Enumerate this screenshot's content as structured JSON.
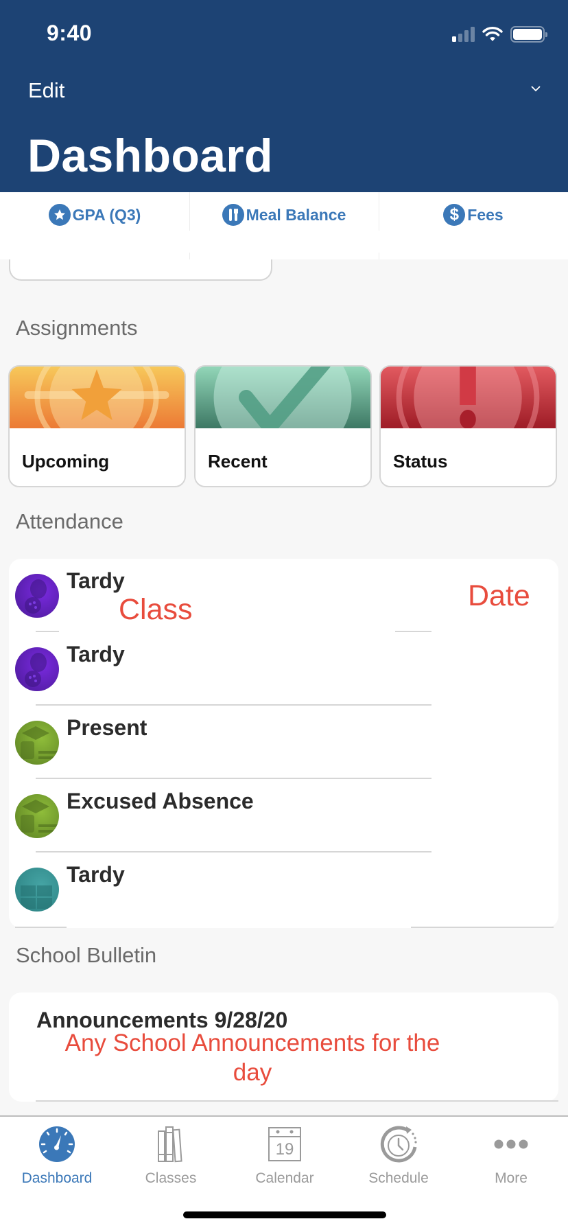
{
  "status_bar": {
    "time": "9:40",
    "icons": [
      "signal-icon",
      "wifi-icon",
      "battery-icon"
    ]
  },
  "header": {
    "edit_label": "Edit",
    "title": "Dashboard",
    "chevron_icon": "chevron-down-icon"
  },
  "quick_tabs": [
    {
      "label": "GPA (Q3)",
      "icon": "star-icon"
    },
    {
      "label": "Meal Balance",
      "icon": "utensils-icon"
    },
    {
      "label": "Fees",
      "icon": "dollar-icon"
    }
  ],
  "sections": {
    "assignments": "Assignments",
    "attendance": "Attendance",
    "bulletin": "School Bulletin"
  },
  "assignments": [
    {
      "label": "Upcoming",
      "icon": "star-badge-icon",
      "colors": [
        "#f7c85a",
        "#ec7a35"
      ]
    },
    {
      "label": "Recent",
      "icon": "checkmark-icon",
      "colors": [
        "#92d6b8",
        "#3d7864"
      ]
    },
    {
      "label": "Status",
      "icon": "exclamation-icon",
      "colors": [
        "#e25a60",
        "#9e1c26"
      ]
    }
  ],
  "attendance": {
    "class_placeholder": "Class",
    "date_placeholder": "Date",
    "rows": [
      {
        "status": "Tardy",
        "avatar": "theater-masks-icon",
        "color": "#5b1fa8"
      },
      {
        "status": "Tardy",
        "avatar": "theater-masks-icon",
        "color": "#5b1fa8"
      },
      {
        "status": "Present",
        "avatar": "graduation-icon",
        "color": "#6f9a2c"
      },
      {
        "status": "Excused Absence",
        "avatar": "graduation-icon",
        "color": "#6f9a2c"
      },
      {
        "status": "Tardy",
        "avatar": "calculator-icon",
        "color": "#2f8b8b"
      }
    ]
  },
  "bulletin": {
    "title": "Announcements 9/28/20",
    "body": "Any School Announcements for the day"
  },
  "tabbar": [
    {
      "label": "Dashboard",
      "icon": "dashboard-gauge-icon",
      "active": true
    },
    {
      "label": "Classes",
      "icon": "books-icon",
      "active": false
    },
    {
      "label": "Calendar",
      "icon": "calendar-icon",
      "active": false,
      "day": "19"
    },
    {
      "label": "Schedule",
      "icon": "schedule-clock-icon",
      "active": false
    },
    {
      "label": "More",
      "icon": "more-dots-icon",
      "active": false
    }
  ],
  "colors": {
    "header": "#1d4374",
    "accent": "#3b78b8",
    "annotation": "#e84c3d",
    "background": "#f7f7f7"
  }
}
